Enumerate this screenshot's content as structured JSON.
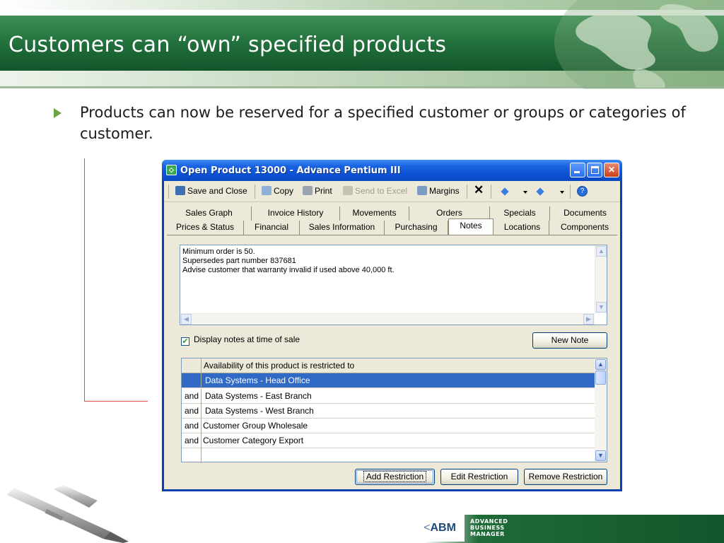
{
  "slide": {
    "title": "Customers can “own” specified products",
    "bullet": "Products  can  now be reserved for a specified customer or groups or categories of customer."
  },
  "window": {
    "title": "Open Product 13000 - Advance  Pentium III",
    "toolbar": {
      "save_close": "Save and Close",
      "copy": "Copy",
      "print": "Print",
      "send_to_excel": "Send to Excel",
      "margins": "Margins"
    },
    "tabs_row1": [
      "Sales Graph",
      "Invoice History",
      "Movements",
      "Orders",
      "Specials",
      "Documents"
    ],
    "tabs_row2": [
      "Prices & Status",
      "Financial",
      "Sales Information",
      "Purchasing",
      "Notes",
      "Locations",
      "Components"
    ],
    "active_tab": "Notes",
    "notes_lines": [
      "Minimum order is 50.",
      "Supersedes part number 837681",
      "Advise customer that warranty invalid if used above 40,000 ft."
    ],
    "display_notes_label": "Display notes at time of sale",
    "display_notes_checked": true,
    "new_note_label": "New Note",
    "grid_header": "Availability of this product is restricted to",
    "grid_rows": [
      {
        "op": "",
        "value": "Data Systems - Head Office",
        "selected": true
      },
      {
        "op": "and",
        "value": "Data Systems - East Branch",
        "selected": false
      },
      {
        "op": "and",
        "value": "Data Systems - West Branch",
        "selected": false
      },
      {
        "op": "and",
        "value": "Customer Group Wholesale",
        "selected": false
      },
      {
        "op": "and",
        "value": "Customer Category Export",
        "selected": false
      }
    ],
    "buttons": {
      "add_restriction": "Add Restriction",
      "edit_restriction": "Edit Restriction",
      "remove_restriction": "Remove Restriction"
    }
  },
  "footer": {
    "logo": "ABM",
    "tagline_lines": [
      "ADVANCED",
      "BUSINESS",
      "MANAGER"
    ]
  },
  "colors": {
    "header_green": "#1f6d3a",
    "bullet_green": "#6aa33f",
    "xp_blue": "#0c52d4",
    "selection_blue": "#316ac5",
    "annotation_red": "#d84a4a"
  }
}
